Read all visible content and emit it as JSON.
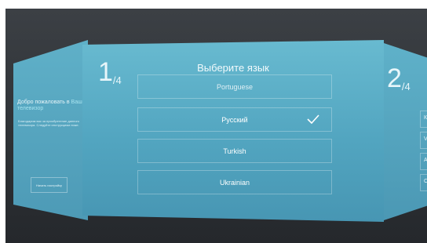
{
  "left_panel": {
    "welcome_part1": "Добро пожаловать в",
    "welcome_highlight": "Ваш телевизор",
    "description": "Благодарим вас за приобретение данного телевизора. Следуйте инструкциям ниже.",
    "button_label": "Начать настройку"
  },
  "center_panel": {
    "step_current": "1",
    "step_total": "/4",
    "title": "Выберите язык",
    "languages": [
      {
        "label": "Portuguese",
        "selected": false,
        "partial": true
      },
      {
        "label": "Русский",
        "selected": true
      },
      {
        "label": "Turkish",
        "selected": false
      },
      {
        "label": "Ukrainian",
        "selected": false
      }
    ]
  },
  "right_panel": {
    "step_current": "2",
    "step_total": "/4",
    "options_letters": [
      "К",
      "V",
      "А",
      "С"
    ]
  },
  "colors": {
    "panel_top": "#68bad0",
    "panel_bottom": "#4796b3",
    "background": "#2e3236"
  }
}
